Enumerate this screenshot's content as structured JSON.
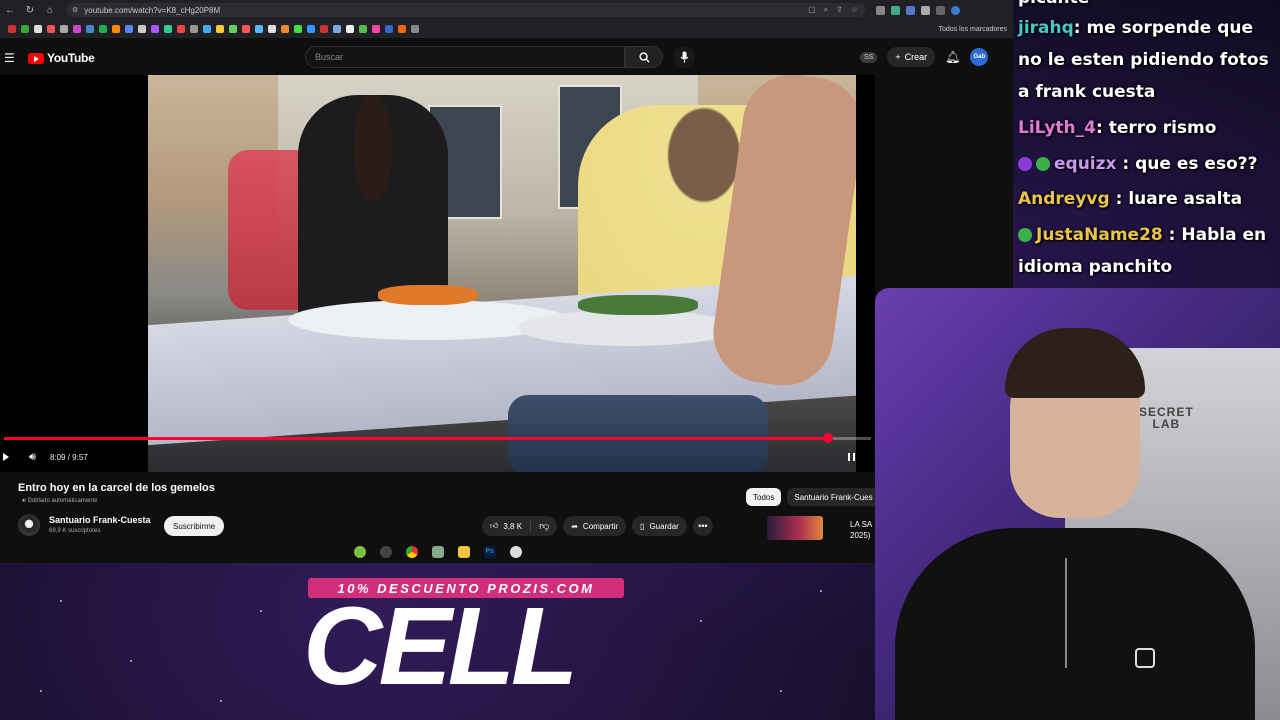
{
  "browser": {
    "url": "youtube.com/watch?v=K8_cHg20P8M",
    "bookmarks_all": "Todos los marcadores"
  },
  "youtube": {
    "logo_text": "YouTube",
    "search_placeholder": "Buscar",
    "ss_badge": "SS",
    "create_label": "Crear",
    "avatar_text": "Gab"
  },
  "player": {
    "time": "8:09 / 9:57",
    "progress": 0.95
  },
  "video": {
    "title": "Entro hoy en la carcel de los gemelos",
    "dub_note": "Doblado automáticamente",
    "channel_name": "Santuario Frank-Cuesta",
    "channel_subs": "69,9 K suscriptores",
    "subscribe_label": "Suscribirme",
    "likes": "3,8 K",
    "share_label": "Compartir",
    "save_label": "Guardar"
  },
  "chips": [
    "Todos",
    "Santuario Frank-Cues"
  ],
  "recommendation": {
    "title_line1": "LA SA",
    "title_line2": "2025)"
  },
  "chat": {
    "messages": [
      {
        "user": "",
        "text": "picante",
        "color": "#ffffff"
      },
      {
        "user": "jirahq",
        "text": ": me sorpende que",
        "color": "#45c9c4"
      },
      {
        "user": "",
        "text": "no le esten pidiendo fotos",
        "color": "#ffffff"
      },
      {
        "user": "",
        "text": "a frank cuesta",
        "color": "#ffffff"
      },
      {
        "user": "LiLyth_4",
        "text": ": terro rismo",
        "color": "#e27ad8"
      },
      {
        "user": "equizx",
        "text": " : que es eso??",
        "color": "#c59af0"
      },
      {
        "user": "Andreyvg",
        "text": " : luare asalta",
        "color": "#e8c44a"
      },
      {
        "user": "JustaName28",
        "text": " : Habla en",
        "color": "#e8c44a"
      },
      {
        "user": "",
        "text": "idioma panchito",
        "color": "#ffffff"
      }
    ]
  },
  "webcam": {
    "chair_logo_line1": "SECRET",
    "chair_logo_line2": "LAB"
  },
  "ad": {
    "promo": "10% DESCUENTO PROZIS.COM",
    "product": "CELL"
  },
  "colors": {
    "youtube_red": "#ff0000",
    "progress_red": "#ff0033",
    "promo_pink": "#d22e7a"
  }
}
